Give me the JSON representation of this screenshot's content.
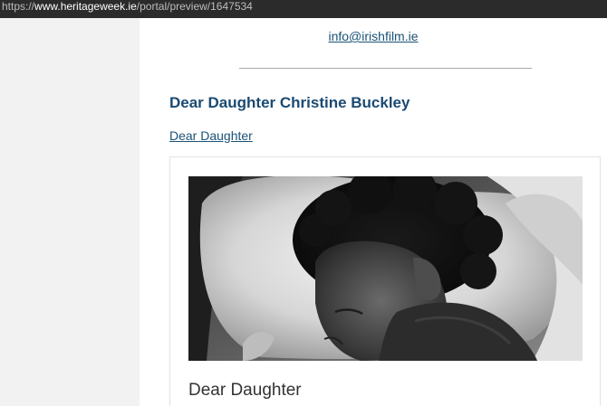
{
  "browser": {
    "url_scheme": "https://",
    "url_host": "www.heritageweek.ie",
    "url_path": "/portal/preview/1647534"
  },
  "page": {
    "email": "info@irishfilm.ie",
    "event_title": "Dear Daughter Christine Buckley",
    "link_label": "Dear Daughter",
    "card": {
      "title": "Dear Daughter"
    }
  },
  "colors": {
    "heading": "#1a4a72",
    "link": "#1a5276"
  }
}
